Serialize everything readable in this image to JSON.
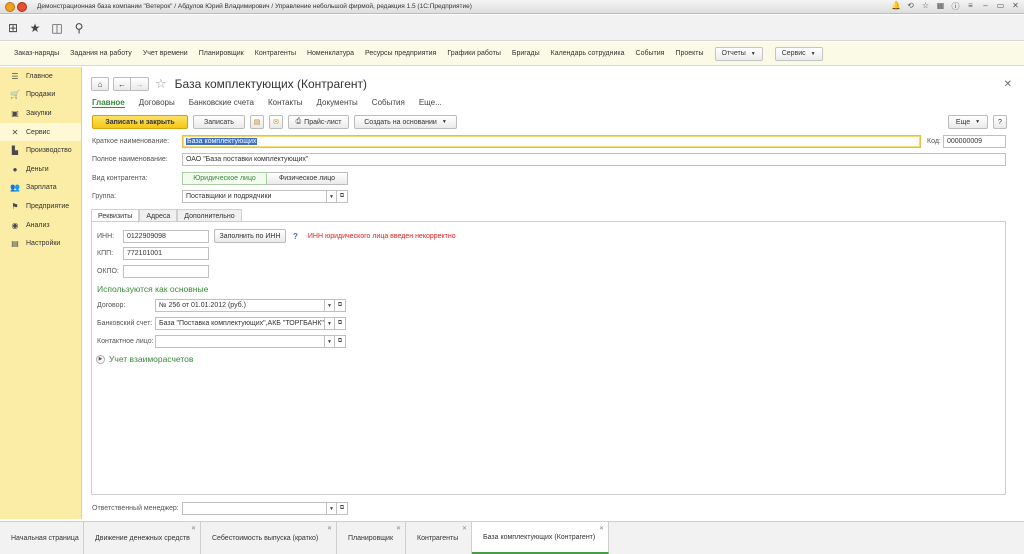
{
  "window": {
    "title": "Демонстрационная база компании \"Ветерок\" / Абдулов Юрий Владимирович / Управление небольшой фирмой, редакция 1.5 (1С:Предприятие)"
  },
  "sections": {
    "links": [
      "Заказ-наряды",
      "Задания на работу",
      "Учет времени",
      "Планировщик",
      "Контрагенты",
      "Номенклатура",
      "Ресурсы предприятия",
      "Графики работы",
      "Бригады",
      "Календарь сотрудника",
      "События",
      "Проекты"
    ],
    "reports_label": "Отчеты",
    "service_label": "Сервис"
  },
  "sidebar": {
    "items": [
      {
        "label": "Главное",
        "icon": "list-icon"
      },
      {
        "label": "Продажи",
        "icon": "cart-icon"
      },
      {
        "label": "Закупки",
        "icon": "truck-icon"
      },
      {
        "label": "Сервис",
        "icon": "tools-icon"
      },
      {
        "label": "Производство",
        "icon": "factory-icon"
      },
      {
        "label": "Деньги",
        "icon": "coins-icon"
      },
      {
        "label": "Зарплата",
        "icon": "people-icon"
      },
      {
        "label": "Предприятие",
        "icon": "flag-icon"
      },
      {
        "label": "Анализ",
        "icon": "chart-icon"
      },
      {
        "label": "Настройки",
        "icon": "settings-icon"
      }
    ],
    "active_index": 3
  },
  "form": {
    "title": "База комплектующих (Контрагент)",
    "tabs": [
      "Главное",
      "Договоры",
      "Банковские счета",
      "Контакты",
      "Документы",
      "События",
      "Еще..."
    ],
    "buttons": {
      "save_close": "Записать и закрыть",
      "save": "Записать",
      "price_list": "Прайс-лист",
      "create_based": "Создать на основании",
      "more": "Еще",
      "help": "?"
    },
    "short_name_label": "Краткое наименование:",
    "short_name_value": "База комплектующих",
    "code_label": "Код:",
    "code_value": "000000009",
    "full_name_label": "Полное наименование:",
    "full_name_value": "ОАО \"База поставки комплектующих\"",
    "kind_label": "Вид контрагента:",
    "kind_legal": "Юридическое лицо",
    "kind_individual": "Физическое лицо",
    "group_label": "Группа:",
    "group_value": "Поставщики и подрядчики",
    "inner_tabs": [
      "Реквизиты",
      "Адреса",
      "Дополнительно"
    ],
    "inn_label": "ИНН:",
    "inn_value": "0122909098",
    "fill_by_inn": "Заполнить по ИНН",
    "inn_help": "?",
    "inn_error": "ИНН юридического лица введен некорректно",
    "kpp_label": "КПП:",
    "kpp_value": "772101001",
    "okpo_label": "ОКПО:",
    "okpo_value": "",
    "defaults_title": "Используются как основные",
    "contract_label": "Договор:",
    "contract_value": "№ 256 от 01.01.2012 (руб.)",
    "bank_label": "Банковский счет:",
    "bank_value": "База \"Поставка комплектующих\",АКБ \"ТОРГБАНК\"",
    "contact_label": "Контактное лицо:",
    "contact_value": "",
    "settlements_label": "Учет взаиморасчетов",
    "manager_label": "Ответственный менеджер:",
    "manager_value": ""
  },
  "bottom_tabs": [
    "Начальная страница",
    "Движение денежных средств",
    "Себестоимость выпуска (кратко)",
    "Планировщик",
    "Контрагенты",
    "База комплектующих (Контрагент)"
  ],
  "colors": {
    "accent_green": "#3a8a3a",
    "primary_yellow": "#f3c814",
    "sidebar_bg": "#fbeca6",
    "error_red": "#e02020"
  }
}
